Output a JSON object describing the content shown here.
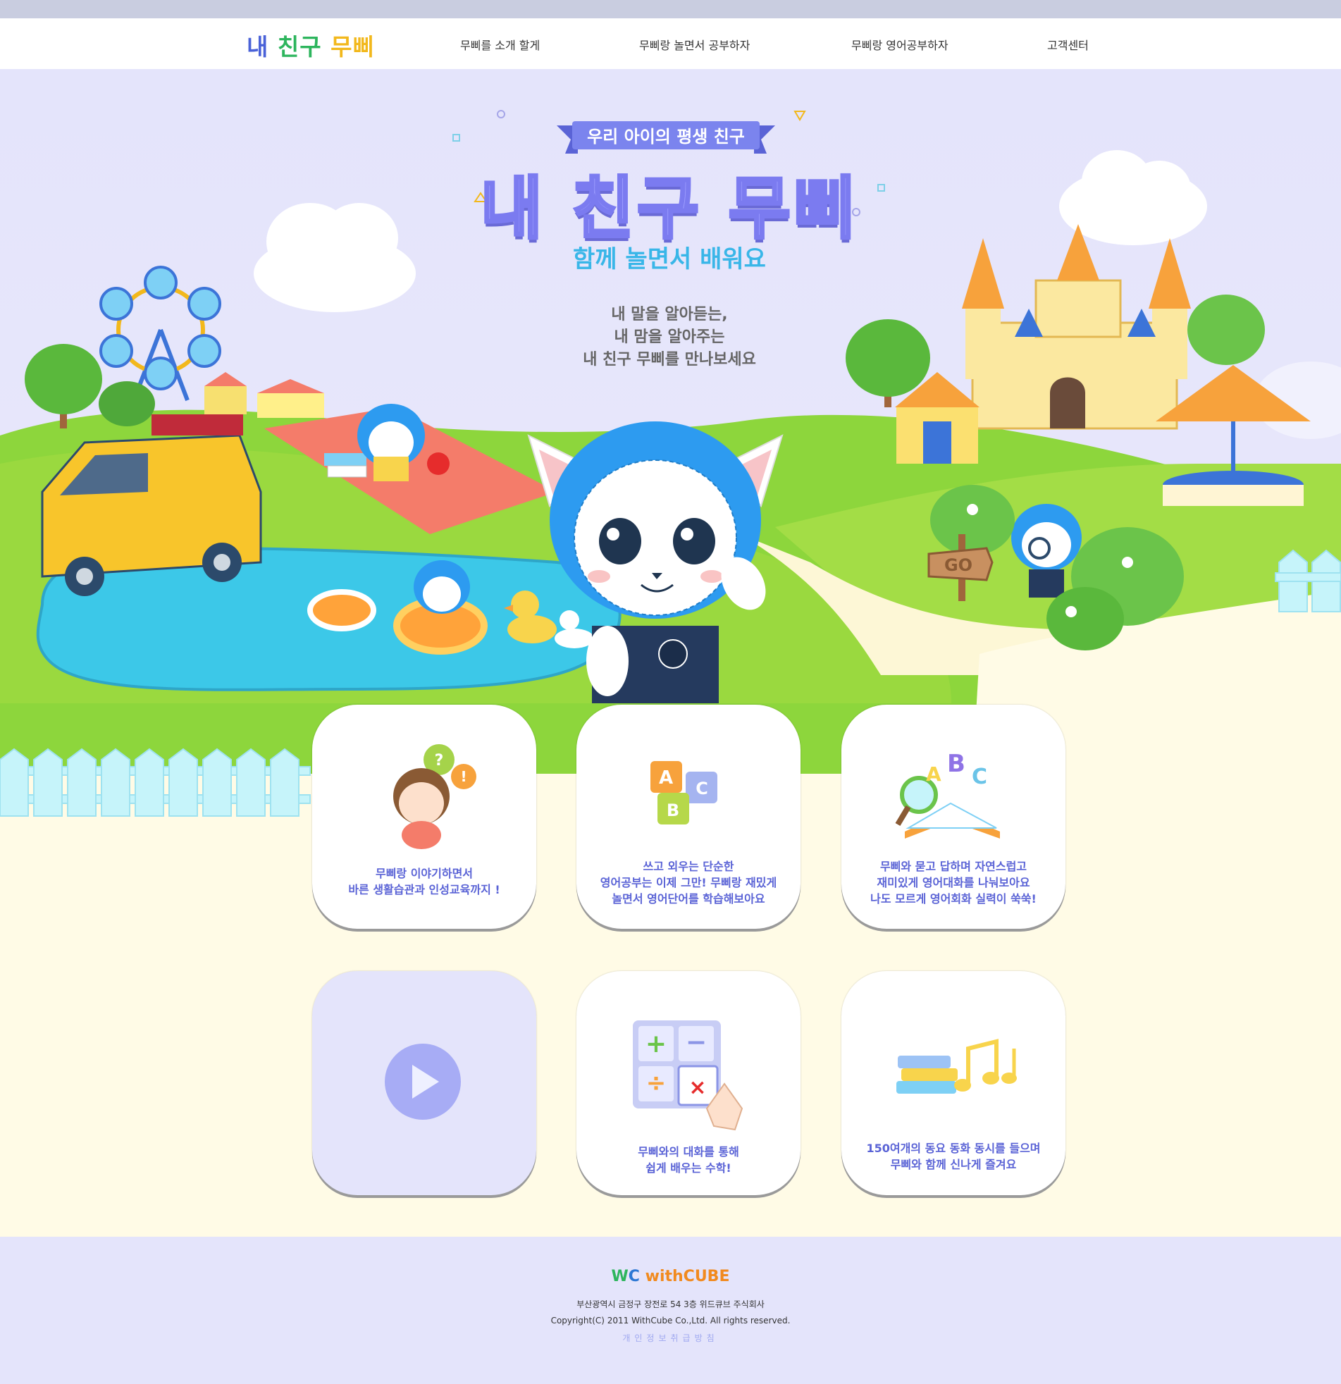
{
  "brand": {
    "logo_part1": "내",
    "logo_part2": "친구",
    "logo_part3": "무삐"
  },
  "nav": {
    "items": [
      {
        "label": "무삐를 소개 할게"
      },
      {
        "label": "무삐랑 놀면서 공부하자"
      },
      {
        "label": "무삐랑 영어공부하자"
      },
      {
        "label": "고객센터"
      }
    ]
  },
  "hero": {
    "ribbon": "우리 아이의 평생 친구",
    "title": "내 친구 무삐",
    "subtitle": "함께 놀면서 배워요",
    "tagline": "내 말을 알아듣는,\n내 맘을 알아주는\n내 친구 무삐를 만나보세요",
    "sign_text": "GO"
  },
  "cards": [
    {
      "text": "무삐랑 이야기하면서\n바른 생활습관과 인성교육까지 !",
      "icon": "girl-question-icon"
    },
    {
      "text": "쓰고 외우는 단순한\n영어공부는 이제 그만! 무삐랑 재밌게\n놀면서 영어단어를 학습해보아요",
      "icon": "abc-blocks-icon"
    },
    {
      "text": "무삐와 묻고 답하며 자연스럽고\n재미있게 영어대화를 나눠보아요\n나도 모르게 영어회화 실력이 쑥쑥!",
      "icon": "book-magnifier-icon"
    },
    {
      "text": "",
      "icon": "play-icon"
    },
    {
      "text": "무삐와의 대화를 통해\n쉽게 배우는 수학!",
      "icon": "calculator-icon"
    },
    {
      "text": "150여개의 동요 동화 동시를 들으며\n무삐와 함께 신나게 즐겨요",
      "icon": "books-music-icon"
    }
  ],
  "footer": {
    "logo_w": "W",
    "logo_c": "C",
    "logo_text": "withCUBE",
    "address": "부산광역시 금정구 장전로 54 3층 위드큐브 주식회사",
    "copyright": "Copyright(C) 2011 WithCube Co.,Ltd. All rights reserved.",
    "privacy": "개인정보취급방침"
  },
  "colors": {
    "accent": "#5a63d6",
    "sky": "#e4e4fb",
    "grass": "#8dd63c",
    "water": "#3cc8e8",
    "mubbi_blue": "#2d9bf0"
  }
}
